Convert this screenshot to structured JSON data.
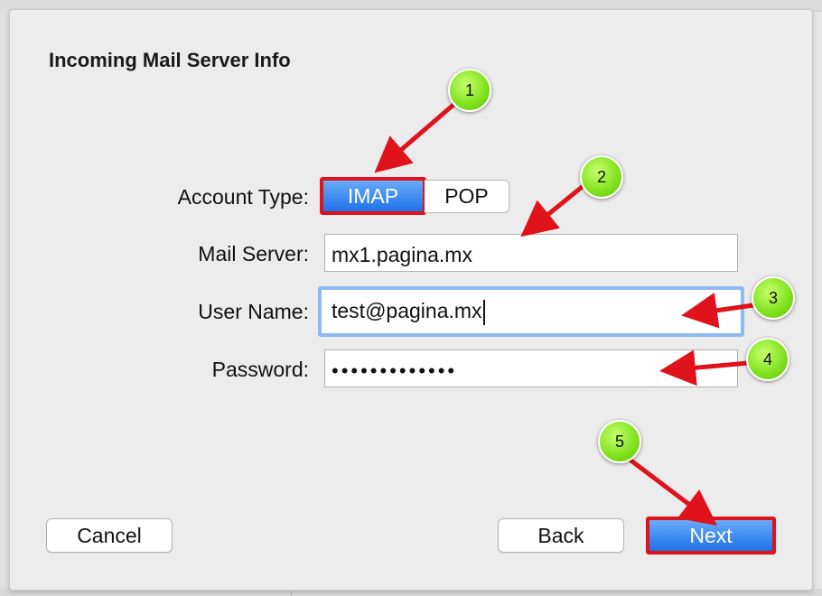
{
  "dialog": {
    "title": "Incoming Mail Server Info"
  },
  "form": {
    "account_type_label": "Account Type:",
    "account_type_options": [
      "IMAP",
      "POP"
    ],
    "account_type_selected": "IMAP",
    "mail_server_label": "Mail Server:",
    "mail_server_value": "mx1.pagina.mx",
    "user_name_label": "User Name:",
    "user_name_value": "test@pagina.mx",
    "password_label": "Password:",
    "password_value": "•••••••••••••"
  },
  "buttons": {
    "cancel": "Cancel",
    "back": "Back",
    "next": "Next"
  },
  "annotations": {
    "markers": [
      "1",
      "2",
      "3",
      "4",
      "5"
    ],
    "highlight_color": "#e0121b",
    "marker_color": "#7fe11c"
  },
  "colors": {
    "accent_blue": "#1e72e8",
    "focus_ring": "#8fbbee"
  }
}
